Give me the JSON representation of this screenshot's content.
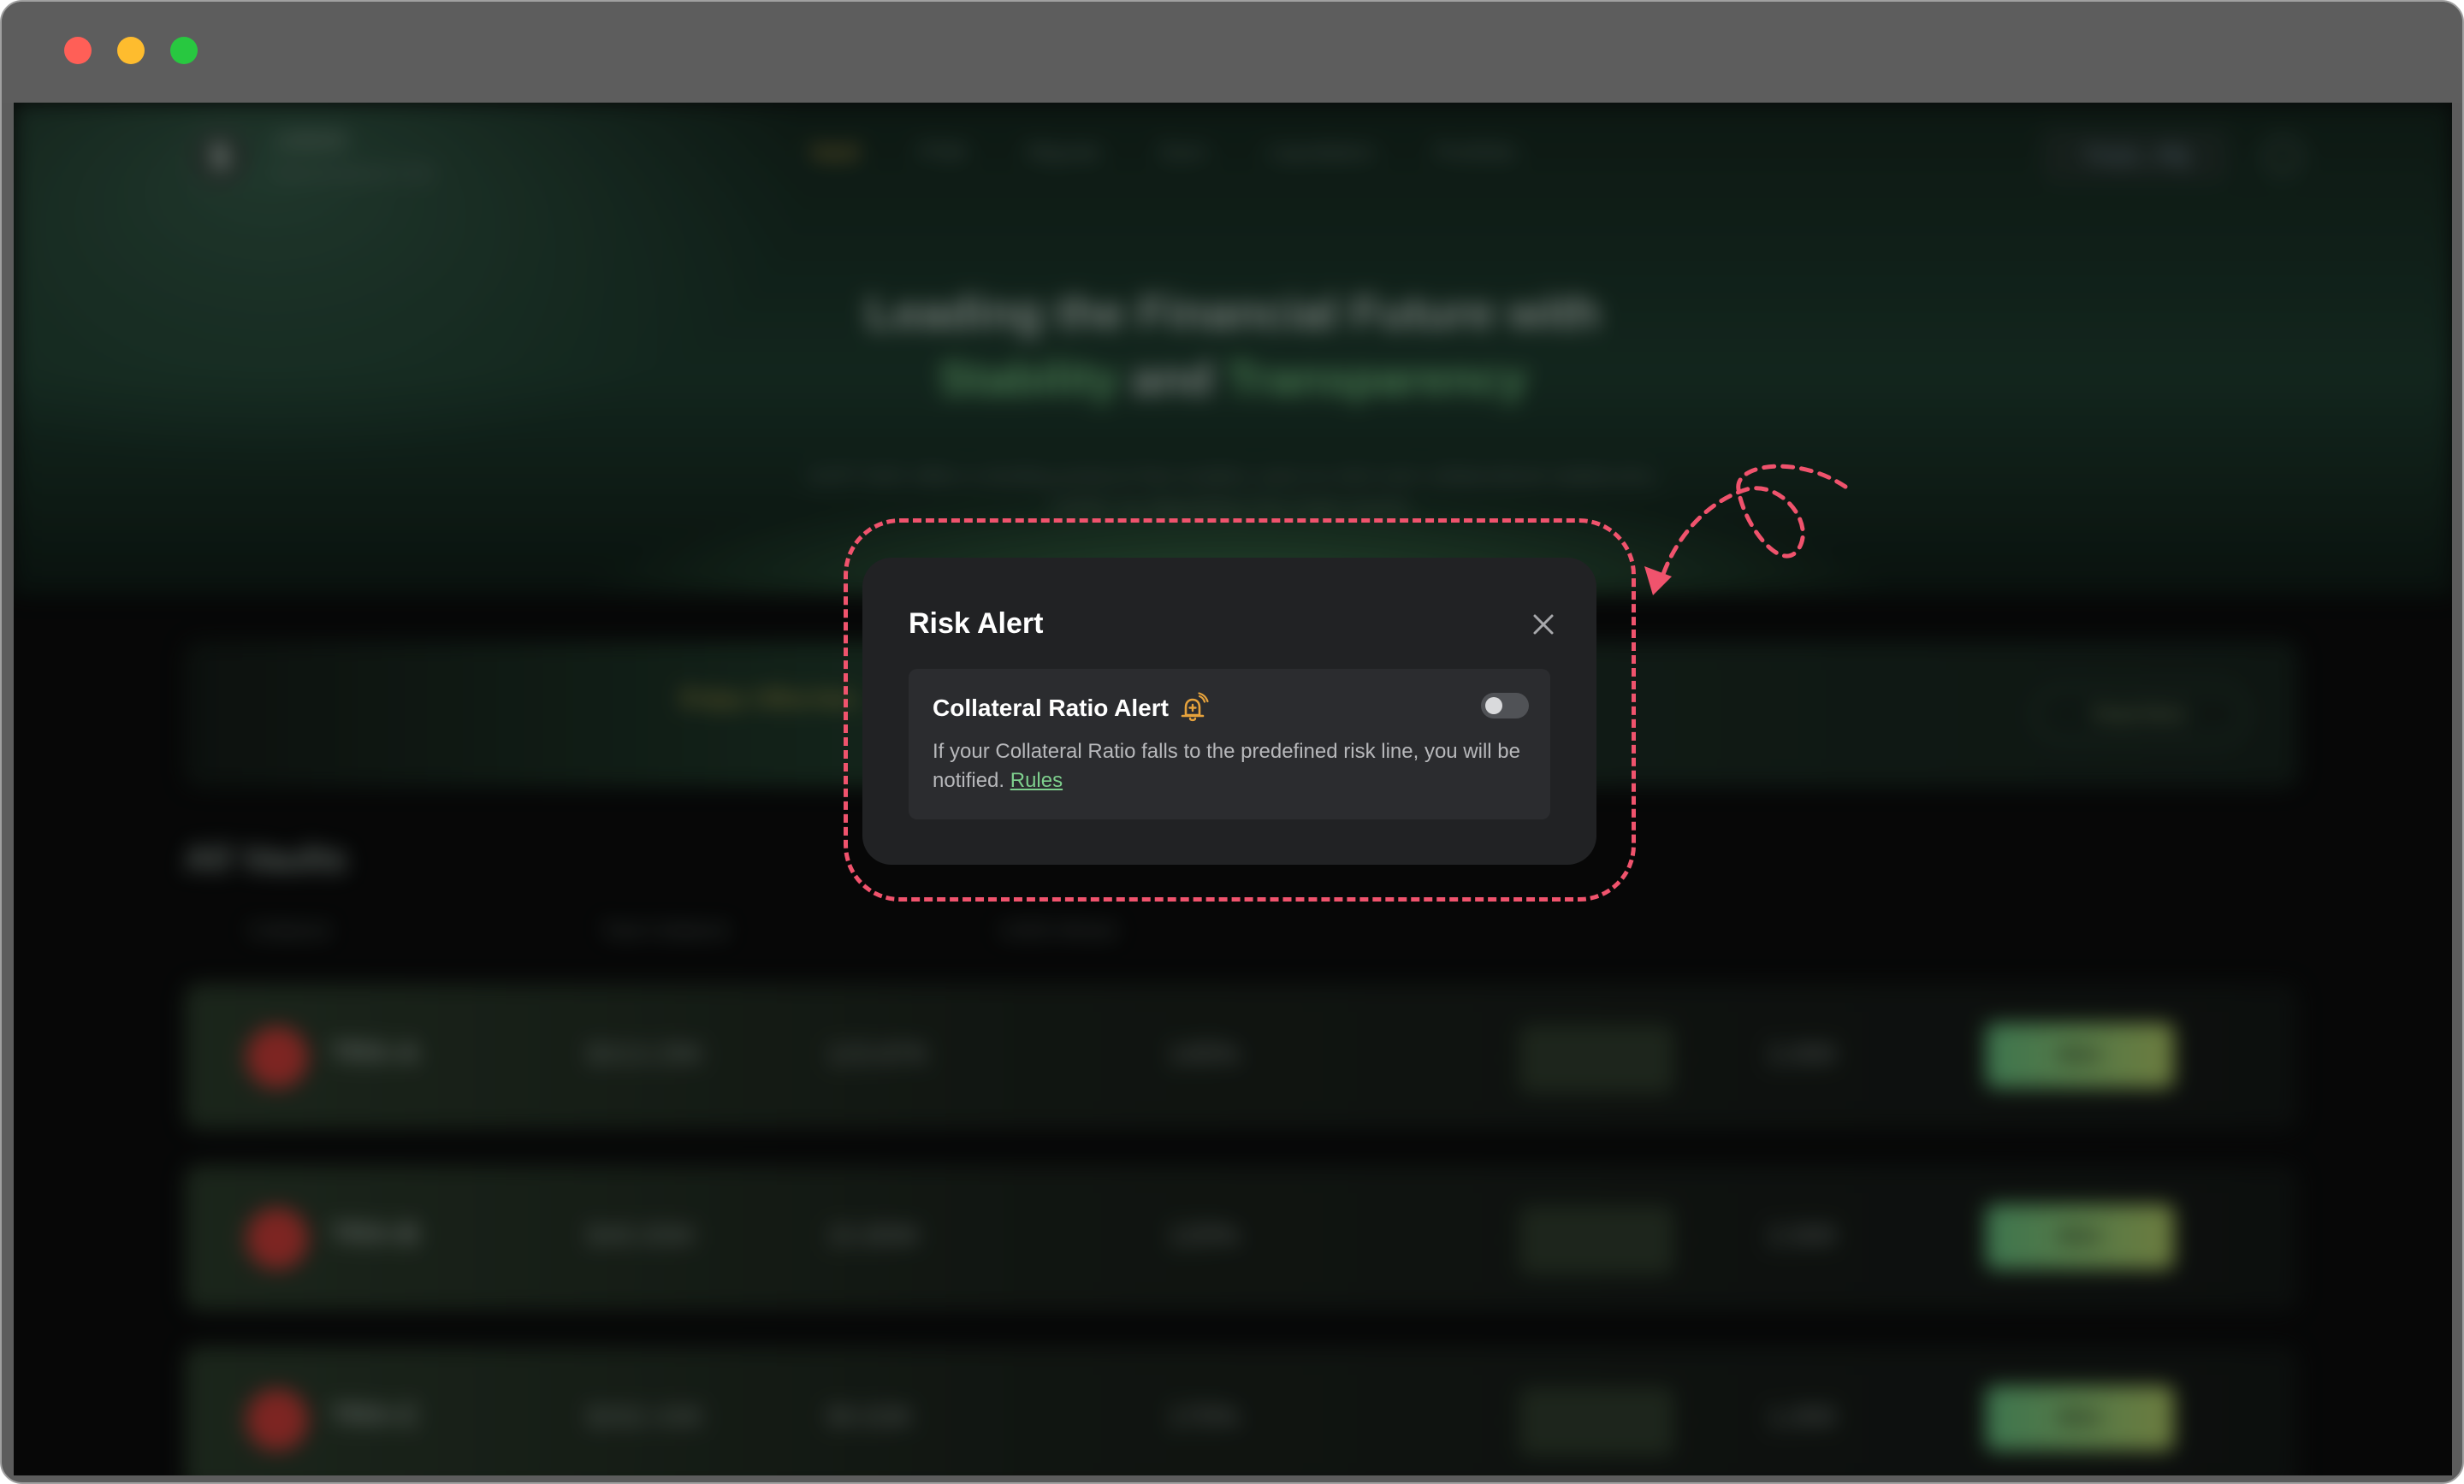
{
  "window": {
    "traffic_lights": [
      "close",
      "minimize",
      "maximize"
    ]
  },
  "background_page": {
    "brand": "USDD",
    "brand_sub": "Decentralized USD",
    "nav": [
      "Vault",
      "PSM",
      "Migrate",
      "Earn",
      "Liquidation",
      "Portfolio"
    ],
    "wallet": "TXoS...P8j",
    "hero_line1": "Leading the Financial Future with",
    "hero_line2_a": "Stability",
    "hero_line2_b": "and",
    "hero_line2_c": "Transparency",
    "hero_desc_1": "JUST DAO offers a lending protocol that enables users to mint over-collateralized stablecoins,",
    "hero_desc_2": "USDD, by depositing Tron chain assets.",
    "banner_text": "Enjoy Ultra-low ... and join HERE!",
    "banner_button": "Read More",
    "vaults_title": "All Vaults",
    "columns": [
      "Collateral",
      "Total Collateral",
      "USDD Minted",
      "Min. Collateral Ratio",
      "Stability Fee",
      "Dust Limit"
    ],
    "rows": [
      {
        "name": "TRX-A",
        "total": "$313.29K",
        "minted": "123.87K",
        "ratio": "145%",
        "dust": "2,000",
        "action": "Mint"
      },
      {
        "name": "TRX-B",
        "total": "$48.00M",
        "minted": "15.80M",
        "ratio": "120%",
        "dust": "2,500",
        "action": "Mint"
      },
      {
        "name": "TRX-C",
        "total": "$262.43K",
        "minted": "90.63K",
        "ratio": "170%",
        "dust": "1,000",
        "action": "Mint"
      }
    ]
  },
  "modal": {
    "title": "Risk Alert",
    "close_icon": "close-icon",
    "card": {
      "title": "Collateral Ratio Alert",
      "icon": "bell-ring-icon",
      "toggle_on": false,
      "description": "If your Collateral Ratio falls to the predefined risk line, you will be notified.",
      "link": "Rules"
    }
  },
  "colors": {
    "annotation": "#f0536d",
    "modal_bg": "#212224",
    "card_bg": "#2b2c2f",
    "link": "#7ecf8d",
    "bell": "#e6a23c"
  }
}
